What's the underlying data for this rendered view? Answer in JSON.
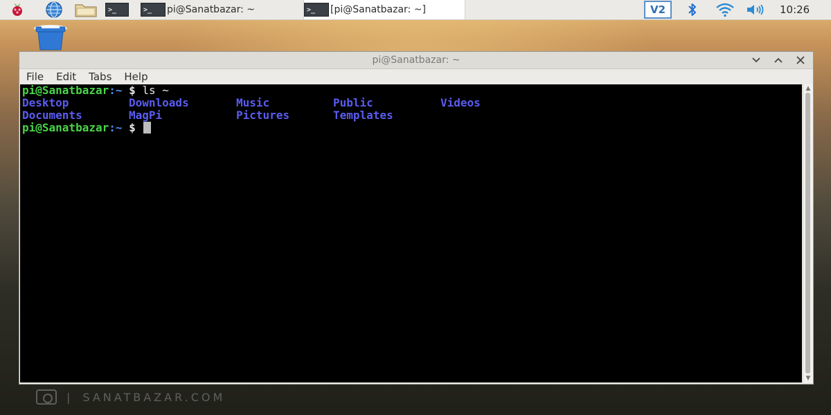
{
  "panel": {
    "tasks": [
      {
        "icon_text": ">_",
        "label": "pi@Sanatbazar: ~"
      },
      {
        "icon_text": ">_",
        "label": "[pi@Sanatbazar: ~]"
      }
    ],
    "vnc_label": "V2",
    "clock": "10:26",
    "icons": [
      "raspberry-pi-menu-icon",
      "web-browser-icon",
      "file-manager-icon",
      "terminal-icon",
      "vnc-icon",
      "bluetooth-icon",
      "wifi-icon",
      "volume-icon"
    ]
  },
  "window": {
    "title": "pi@Sanatbazar: ~",
    "menu": [
      "File",
      "Edit",
      "Tabs",
      "Help"
    ],
    "controls": [
      "minimize",
      "maximize",
      "close"
    ]
  },
  "terminal": {
    "prompt_user": "pi@Sanatbazar",
    "prompt_path": ":~",
    "prompt_symbol": " $ ",
    "command": "ls ~",
    "listing": [
      [
        "Desktop",
        "Downloads",
        "Music",
        "Public",
        "Videos"
      ],
      [
        "Documents",
        "MagPi",
        "Pictures",
        "Templates"
      ]
    ]
  },
  "watermark": {
    "text": "SANATBAZAR.COM"
  },
  "colors": {
    "prompt_user": "#49d549",
    "prompt_path": "#4d8cf0",
    "directory": "#5a5cf0",
    "terminal_bg": "#000000"
  }
}
